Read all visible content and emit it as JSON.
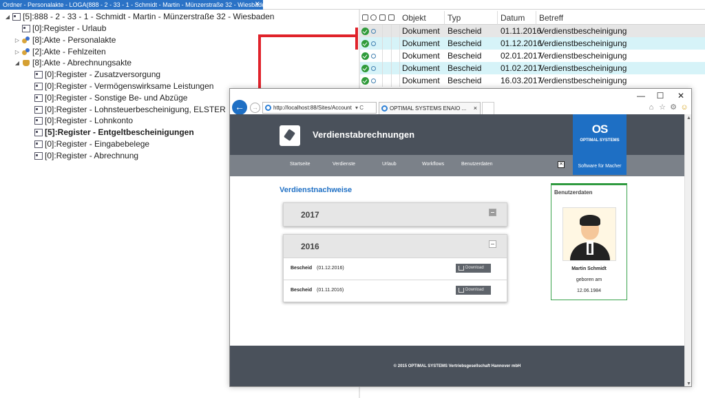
{
  "tab": {
    "title": "Ordner - Personalakte - LOGA(888 - 2 - 33 - 1 - Schmidt - Martin - Münzerstraße 32 - Wiesbaden)",
    "close": "✕"
  },
  "tree": {
    "root": {
      "label": "[5]:888 - 2 - 33 - 1 - Schmidt - Martin - Münzerstraße 32 - Wiesbaden",
      "expander": "◢"
    },
    "items": [
      {
        "label": "[0]:Register - Urlaub",
        "expander": "",
        "icon": "register-icon"
      },
      {
        "label": "[8]:Akte - Personalakte",
        "expander": "▷",
        "icon": "akte-icon"
      },
      {
        "label": "[2]:Akte - Fehlzeiten",
        "expander": "▷",
        "icon": "akte-icon"
      },
      {
        "label": "[8]:Akte - Abrechnungsakte",
        "expander": "◢",
        "icon": "abrechnungsakte-icon"
      },
      {
        "label": "[0]:Register - Zusatzversorgung",
        "expander": "",
        "icon": "register-icon"
      },
      {
        "label": "[0]:Register - Vermögenswirksame Leistungen",
        "expander": "",
        "icon": "register-icon"
      },
      {
        "label": "[0]:Register - Sonstige Be- und Abzüge",
        "expander": "",
        "icon": "register-icon"
      },
      {
        "label": "[0]:Register - Lohnsteuerbescheinigung, ELSTER",
        "expander": "",
        "icon": "register-icon"
      },
      {
        "label": "[0]:Register - Lohnkonto",
        "expander": "",
        "icon": "register-icon"
      },
      {
        "label": "[5]:Register - Entgeltbescheinigungen",
        "expander": "",
        "icon": "register-icon"
      },
      {
        "label": "[0]:Register - Eingabebelege",
        "expander": "",
        "icon": "register-icon"
      },
      {
        "label": "[0]:Register - Abrechnung",
        "expander": "",
        "icon": "register-icon"
      }
    ]
  },
  "doclist": {
    "columns": [
      "Objekt",
      "Typ",
      "Datum",
      "Betreff"
    ],
    "rows": [
      {
        "objekt": "Dokument",
        "typ": "Bescheid",
        "datum": "01.11.2016",
        "betreff": "Verdienstbescheinigung",
        "bg": "#e6e6e6"
      },
      {
        "objekt": "Dokument",
        "typ": "Bescheid",
        "datum": "01.12.2016",
        "betreff": "Verdienstbescheinigung",
        "bg": "#d6f3f8"
      },
      {
        "objekt": "Dokument",
        "typ": "Bescheid",
        "datum": "02.01.2017",
        "betreff": "Verdienstbescheinigung",
        "bg": "#ffffff"
      },
      {
        "objekt": "Dokument",
        "typ": "Bescheid",
        "datum": "01.02.2017",
        "betreff": "Verdienstbescheinigung",
        "bg": "#d6f3f8"
      },
      {
        "objekt": "Dokument",
        "typ": "Bescheid",
        "datum": "16.03.2017",
        "betreff": "Verdienstbescheinigung",
        "bg": "#ffffff"
      }
    ]
  },
  "browser": {
    "address": "http://localhost:88/Sites/Account",
    "address_controls": "▾ C",
    "tab_title": "OPTIMAL SYSTEMS ENAIO ...",
    "tab_close": "×",
    "back": "←",
    "forward": "→",
    "win_min": "—",
    "win_max": "☐",
    "win_close": "✕",
    "toolbar_icons": [
      "home-icon",
      "star-icon",
      "gear-icon",
      "smiley-icon"
    ]
  },
  "webapp": {
    "title": "Verdienstabrechnungen",
    "brand": {
      "mark": "OS",
      "name": "OPTIMAL SYSTEMS",
      "slogan": "Software für Macher"
    },
    "menu": [
      "Startseite",
      "Verdienste",
      "Urlaub",
      "Workflows",
      "Benutzerdaten"
    ],
    "logout_glyph": "✕",
    "section_title": "Verdienstnachweise",
    "years": [
      {
        "year": "2017",
        "expanded": false,
        "items": []
      },
      {
        "year": "2016",
        "expanded": true,
        "items": [
          {
            "name": "Bescheid",
            "date": "(01.12.2016)",
            "button": "Download"
          },
          {
            "name": "Bescheid",
            "date": "(01.11.2016)",
            "button": "Download"
          }
        ]
      }
    ],
    "user": {
      "heading": "Benutzerdaten",
      "name": "Martin Schmidt",
      "born_label": "geboren am",
      "born_date": "12.06.1984"
    },
    "footer": "© 2015 OPTIMAL SYSTEMS Vertriebsgesellschaft Hannover mbH"
  },
  "colors": {
    "accent": "#1e6fc4",
    "arrow": "#e0222a",
    "header": "#4a515b",
    "menu": "#7b8189",
    "ok": "#2f9b3a"
  }
}
